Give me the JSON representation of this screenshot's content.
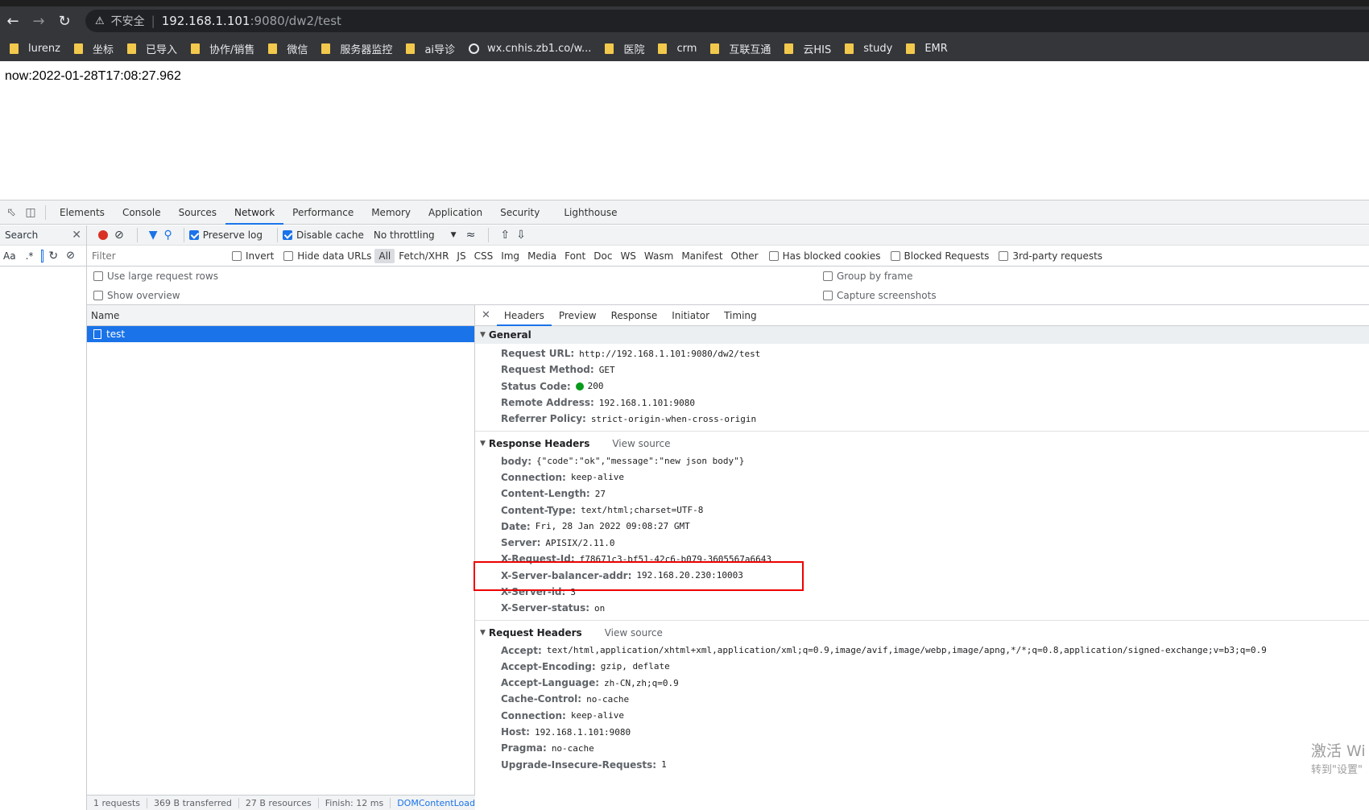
{
  "browser": {
    "security_label": "不安全",
    "url_host": "192.168.1.101",
    "url_rest": ":9080/dw2/test",
    "bookmarks": [
      "lurenz",
      "坐标",
      "已导入",
      "协作/销售",
      "微信",
      "服务器监控",
      "ai导诊",
      "wx.cnhis.zb1.co/w...",
      "医院",
      "crm",
      "互联互通",
      "云HIS",
      "study",
      "EMR"
    ]
  },
  "page": {
    "now_text": "now:2022-01-28T17:08:27.962"
  },
  "devtools": {
    "tabs": [
      "Elements",
      "Console",
      "Sources",
      "Network",
      "Performance",
      "Memory",
      "Application",
      "Security",
      "Lighthouse"
    ],
    "search": {
      "label": "Search",
      "aa": "Aa",
      "regex": ".*"
    },
    "toolbar": {
      "preserve_log": "Preserve log",
      "disable_cache": "Disable cache",
      "throttling": "No throttling"
    },
    "filter": {
      "placeholder": "Filter",
      "invert": "Invert",
      "hide_data_urls": "Hide data URLs",
      "types": [
        "All",
        "Fetch/XHR",
        "JS",
        "CSS",
        "Img",
        "Media",
        "Font",
        "Doc",
        "WS",
        "Wasm",
        "Manifest",
        "Other"
      ],
      "has_blocked_cookies": "Has blocked cookies",
      "blocked_requests": "Blocked Requests",
      "third_party": "3rd-party requests"
    },
    "settings": {
      "large_rows": "Use large request rows",
      "show_overview": "Show overview",
      "group_by_frame": "Group by frame",
      "capture_screenshots": "Capture screenshots"
    },
    "list": {
      "name_header": "Name",
      "request_name": "test",
      "status": [
        "1 requests",
        "369 B transferred",
        "27 B resources",
        "Finish: 12 ms",
        "DOMContentLoaded"
      ]
    },
    "detail_tabs": [
      "Headers",
      "Preview",
      "Response",
      "Initiator",
      "Timing"
    ],
    "general": {
      "title": "General",
      "rows": [
        {
          "k": "Request URL:",
          "v": "http://192.168.1.101:9080/dw2/test"
        },
        {
          "k": "Request Method:",
          "v": "GET"
        },
        {
          "k": "Status Code:",
          "v": "200"
        },
        {
          "k": "Remote Address:",
          "v": "192.168.1.101:9080"
        },
        {
          "k": "Referrer Policy:",
          "v": "strict-origin-when-cross-origin"
        }
      ]
    },
    "response_headers": {
      "title": "Response Headers",
      "view_source": "View source",
      "rows": [
        {
          "k": "body:",
          "v": "{\"code\":\"ok\",\"message\":\"new json body\"}"
        },
        {
          "k": "Connection:",
          "v": "keep-alive"
        },
        {
          "k": "Content-Length:",
          "v": "27"
        },
        {
          "k": "Content-Type:",
          "v": "text/html;charset=UTF-8"
        },
        {
          "k": "Date:",
          "v": "Fri, 28 Jan 2022 09:08:27 GMT"
        },
        {
          "k": "Server:",
          "v": "APISIX/2.11.0"
        },
        {
          "k": "X-Request-Id:",
          "v": "f78671c3-bf51-42c6-b079-3605567a6643"
        },
        {
          "k": "X-Server-balancer-addr:",
          "v": "192.168.20.230:10003"
        },
        {
          "k": "X-Server-id:",
          "v": "3"
        },
        {
          "k": "X-Server-status:",
          "v": "on"
        }
      ]
    },
    "request_headers": {
      "title": "Request Headers",
      "view_source": "View source",
      "rows": [
        {
          "k": "Accept:",
          "v": "text/html,application/xhtml+xml,application/xml;q=0.9,image/avif,image/webp,image/apng,*/*;q=0.8,application/signed-exchange;v=b3;q=0.9"
        },
        {
          "k": "Accept-Encoding:",
          "v": "gzip, deflate"
        },
        {
          "k": "Accept-Language:",
          "v": "zh-CN,zh;q=0.9"
        },
        {
          "k": "Cache-Control:",
          "v": "no-cache"
        },
        {
          "k": "Connection:",
          "v": "keep-alive"
        },
        {
          "k": "Host:",
          "v": "192.168.1.101:9080"
        },
        {
          "k": "Pragma:",
          "v": "no-cache"
        },
        {
          "k": "Upgrade-Insecure-Requests:",
          "v": "1"
        }
      ]
    }
  },
  "watermark": {
    "line1": "激活 Wi",
    "line2": "转到\"设置\""
  },
  "colors": {
    "accent": "#1a73e8",
    "highlight": "#e00000",
    "status_ok": "#0a9a1c"
  }
}
